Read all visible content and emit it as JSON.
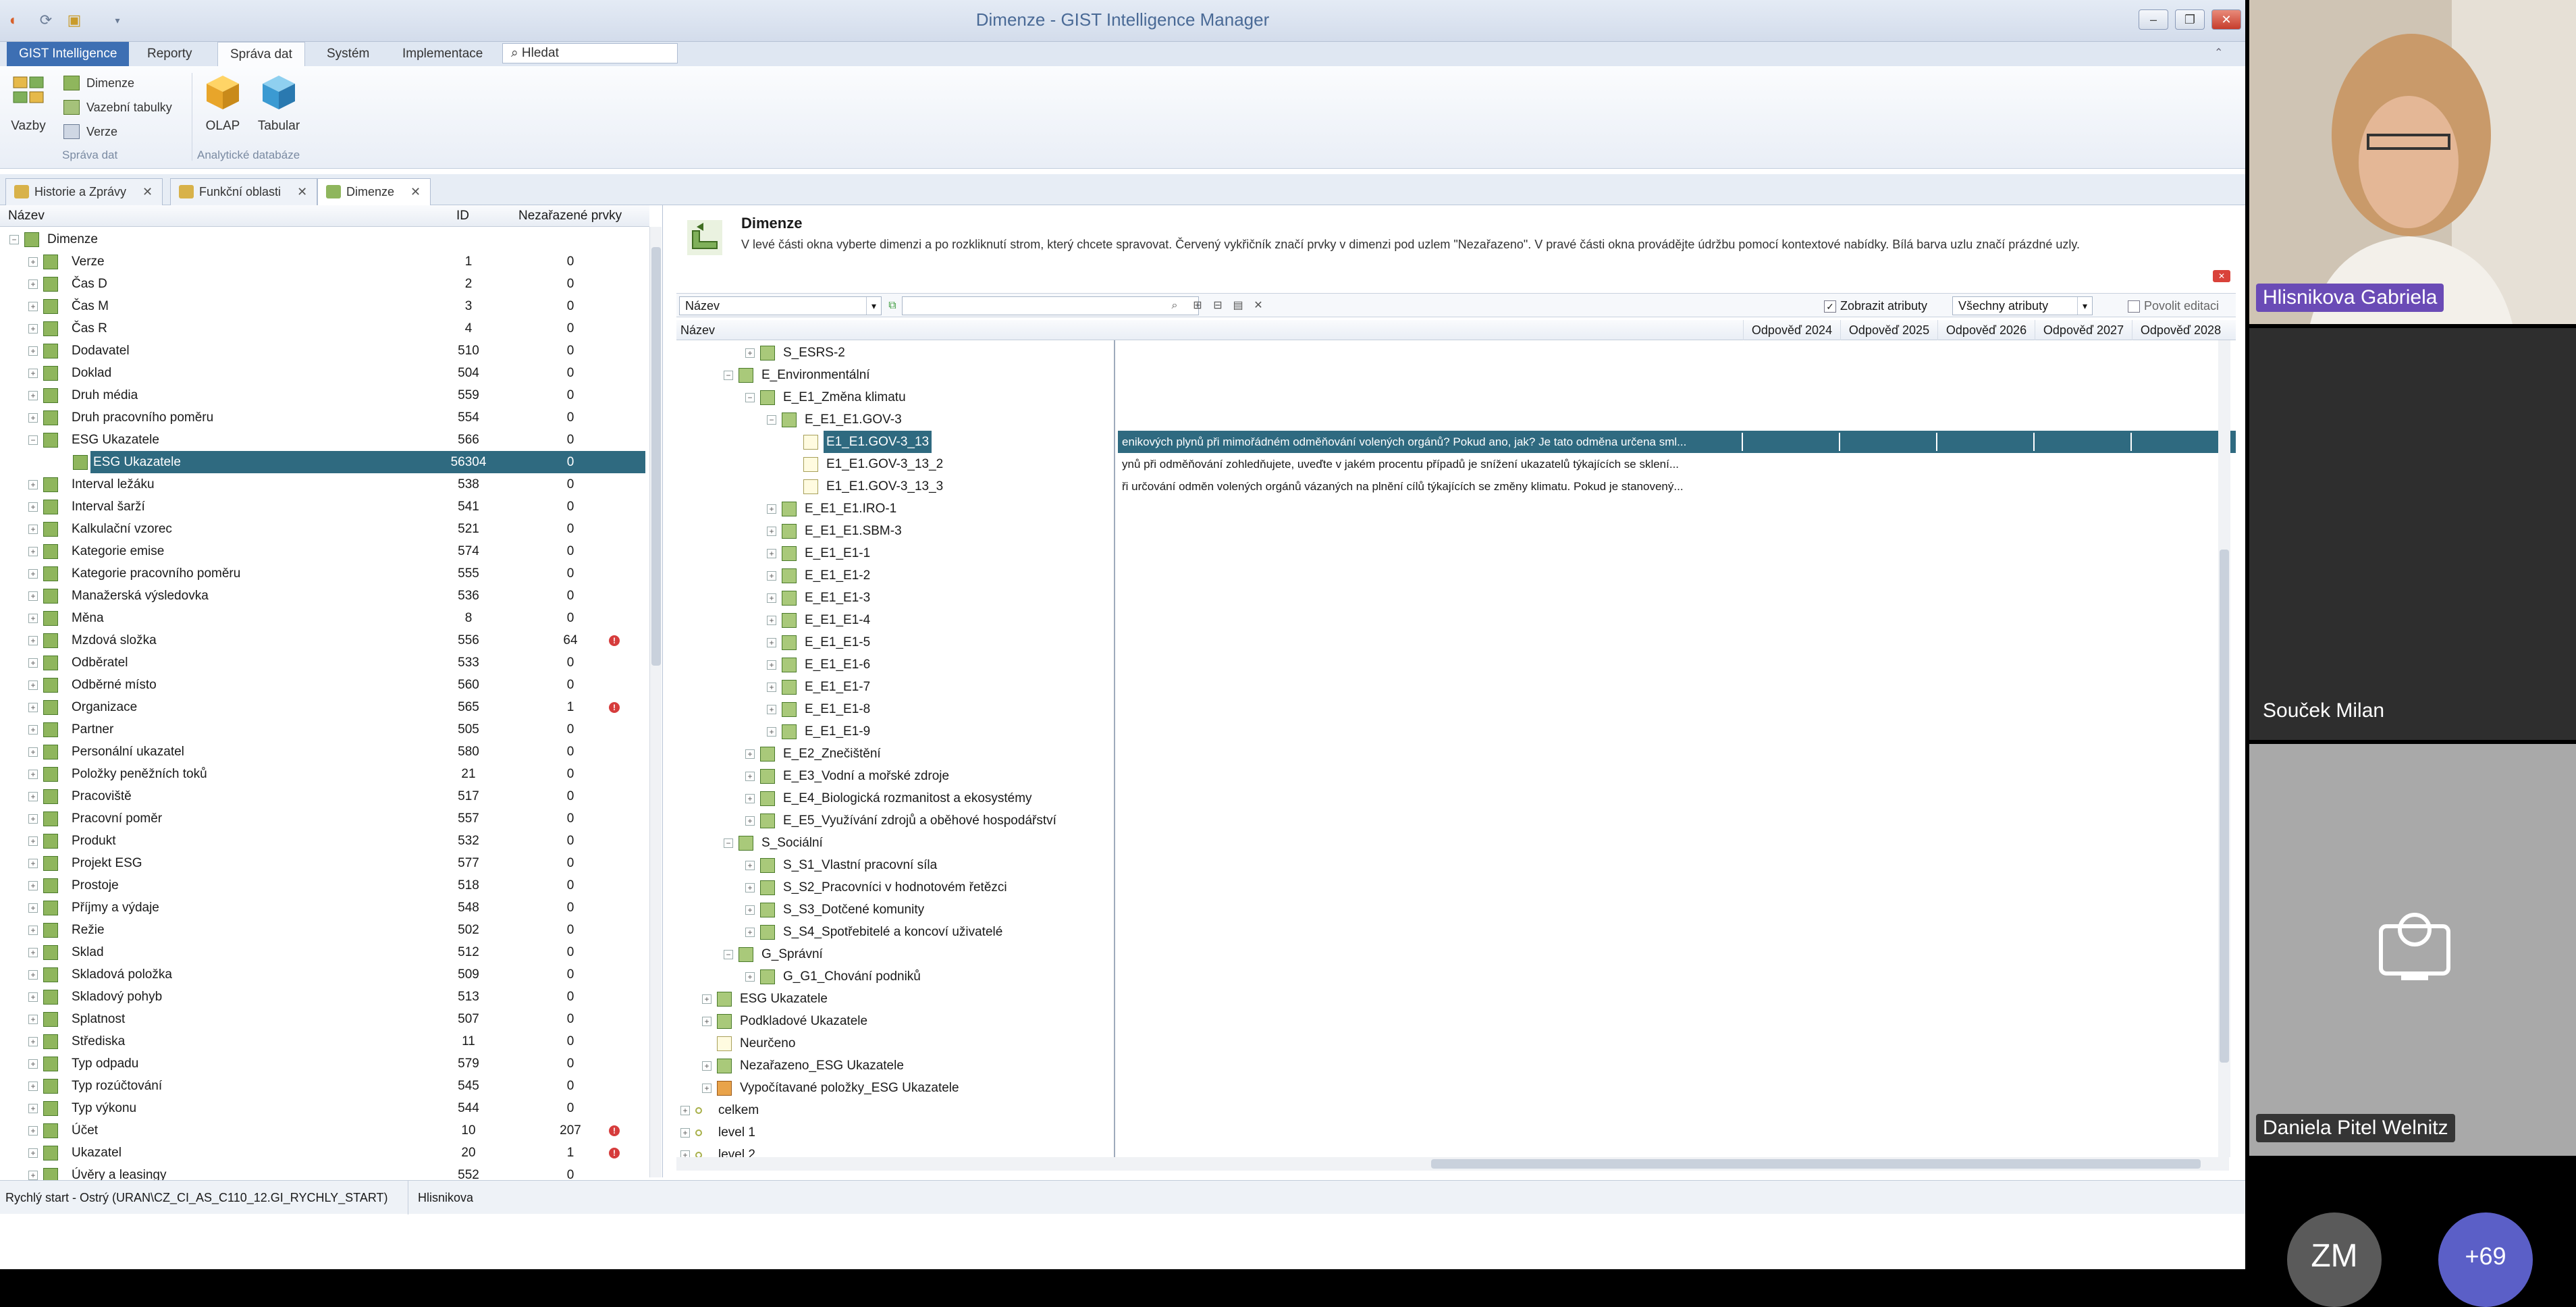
{
  "window": {
    "title": "Dimenze - GIST Intelligence Manager"
  },
  "menu": {
    "tabs": [
      "GIST Intelligence",
      "Reporty",
      "Správa dat",
      "Systém",
      "Implementace"
    ],
    "search_value": "Hledat"
  },
  "ribbon": {
    "vazby": "Vazby",
    "dimenze": "Dimenze",
    "vazebni": "Vazební tabulky",
    "verze": "Verze",
    "olap": "OLAP",
    "tabular": "Tabular",
    "group1": "Správa dat",
    "group2": "Analytické databáze"
  },
  "doc_tabs": [
    "Historie a Zprávy",
    "Funkční oblasti",
    "Dimenze"
  ],
  "left": {
    "headers": {
      "name": "Název",
      "id": "ID",
      "unassigned": "Nezařazené prvky"
    },
    "root": "Dimenze",
    "rows": [
      {
        "name": "Verze",
        "id": "1",
        "n": "0"
      },
      {
        "name": "Čas D",
        "id": "2",
        "n": "0"
      },
      {
        "name": "Čas M",
        "id": "3",
        "n": "0"
      },
      {
        "name": "Čas R",
        "id": "4",
        "n": "0"
      },
      {
        "name": "Dodavatel",
        "id": "510",
        "n": "0"
      },
      {
        "name": "Doklad",
        "id": "504",
        "n": "0"
      },
      {
        "name": "Druh média",
        "id": "559",
        "n": "0"
      },
      {
        "name": "Druh pracovního poměru",
        "id": "554",
        "n": "0"
      },
      {
        "name": "ESG Ukazatele",
        "id": "566",
        "n": "0"
      },
      {
        "name": "ESG Ukazatele",
        "id": "56304",
        "n": "0"
      },
      {
        "name": "Interval ležáku",
        "id": "538",
        "n": "0"
      },
      {
        "name": "Interval šarží",
        "id": "541",
        "n": "0"
      },
      {
        "name": "Kalkulační vzorec",
        "id": "521",
        "n": "0"
      },
      {
        "name": "Kategorie emise",
        "id": "574",
        "n": "0"
      },
      {
        "name": "Kategorie pracovního poměru",
        "id": "555",
        "n": "0"
      },
      {
        "name": "Manažerská výsledovka",
        "id": "536",
        "n": "0"
      },
      {
        "name": "Měna",
        "id": "8",
        "n": "0"
      },
      {
        "name": "Mzdová složka",
        "id": "556",
        "n": "64"
      },
      {
        "name": "Odběratel",
        "id": "533",
        "n": "0"
      },
      {
        "name": "Odběrné místo",
        "id": "560",
        "n": "0"
      },
      {
        "name": "Organizace",
        "id": "565",
        "n": "1"
      },
      {
        "name": "Partner",
        "id": "505",
        "n": "0"
      },
      {
        "name": "Personální ukazatel",
        "id": "580",
        "n": "0"
      },
      {
        "name": "Položky peněžních toků",
        "id": "21",
        "n": "0"
      },
      {
        "name": "Pracoviště",
        "id": "517",
        "n": "0"
      },
      {
        "name": "Pracovní poměr",
        "id": "557",
        "n": "0"
      },
      {
        "name": "Produkt",
        "id": "532",
        "n": "0"
      },
      {
        "name": "Projekt ESG",
        "id": "577",
        "n": "0"
      },
      {
        "name": "Prostoje",
        "id": "518",
        "n": "0"
      },
      {
        "name": "Příjmy a výdaje",
        "id": "548",
        "n": "0"
      },
      {
        "name": "Režie",
        "id": "502",
        "n": "0"
      },
      {
        "name": "Sklad",
        "id": "512",
        "n": "0"
      },
      {
        "name": "Skladová položka",
        "id": "509",
        "n": "0"
      },
      {
        "name": "Skladový pohyb",
        "id": "513",
        "n": "0"
      },
      {
        "name": "Splatnost",
        "id": "507",
        "n": "0"
      },
      {
        "name": "Střediska",
        "id": "11",
        "n": "0"
      },
      {
        "name": "Typ odpadu",
        "id": "579",
        "n": "0"
      },
      {
        "name": "Typ rozúčtování",
        "id": "545",
        "n": "0"
      },
      {
        "name": "Typ výkonu",
        "id": "544",
        "n": "0"
      },
      {
        "name": "Účet",
        "id": "10",
        "n": "207"
      },
      {
        "name": "Ukazatel",
        "id": "20",
        "n": "1"
      },
      {
        "name": "Úvěry a leasingy",
        "id": "552",
        "n": "0"
      }
    ]
  },
  "right": {
    "help_title": "Dimenze",
    "help_text": "V levé části okna vyberte dimenzi a po rozkliknutí strom, který chcete spravovat. Červený vykřičník značí prvky v dimenzi pod uzlem \"Nezařazeno\". V pravé části okna provádějte údržbu pomocí kontextové nabídky. Bílá barva uzlu značí prázdné uzly.",
    "combo_value": "Název",
    "show_attrs": "Zobrazit atributy",
    "attrs_value": "Všechny atributy",
    "allow_edit": "Povolit editaci",
    "headers": [
      "Název",
      "Odpověď 2024",
      "Odpověď 2025",
      "Odpověď 2026",
      "Odpověď 2027",
      "Odpověď 2028"
    ],
    "rows": [
      {
        "name": "S_ESRS-2",
        "desc": ""
      },
      {
        "name": "E_Environmentální",
        "desc": ""
      },
      {
        "name": "E_E1_Změna klimatu",
        "desc": ""
      },
      {
        "name": "E_E1_E1.GOV-3",
        "desc": ""
      },
      {
        "name": "E1_E1.GOV-3_13",
        "desc": "enikových plynů při mimořádném odměňování volených orgánů? Pokud ano, jak? Je tato odměna určena sml..."
      },
      {
        "name": "E1_E1.GOV-3_13_2",
        "desc": "ynů při odměňování zohledňujete, uveďte v jakém procentu případů je snížení ukazatelů týkajících se sklení..."
      },
      {
        "name": "E1_E1.GOV-3_13_3",
        "desc": "ři určování odměn volených orgánů vázaných na plnění cílů týkajících se změny klimatu. Pokud je stanovený..."
      },
      {
        "name": "E_E1_E1.IRO-1",
        "desc": ""
      },
      {
        "name": "E_E1_E1.SBM-3",
        "desc": ""
      },
      {
        "name": "E_E1_E1-1",
        "desc": ""
      },
      {
        "name": "E_E1_E1-2",
        "desc": ""
      },
      {
        "name": "E_E1_E1-3",
        "desc": ""
      },
      {
        "name": "E_E1_E1-4",
        "desc": ""
      },
      {
        "name": "E_E1_E1-5",
        "desc": ""
      },
      {
        "name": "E_E1_E1-6",
        "desc": ""
      },
      {
        "name": "E_E1_E1-7",
        "desc": ""
      },
      {
        "name": "E_E1_E1-8",
        "desc": ""
      },
      {
        "name": "E_E1_E1-9",
        "desc": ""
      },
      {
        "name": "E_E2_Znečištění",
        "desc": ""
      },
      {
        "name": "E_E3_Vodní a mořské zdroje",
        "desc": ""
      },
      {
        "name": "E_E4_Biologická rozmanitost a ekosystémy",
        "desc": ""
      },
      {
        "name": "E_E5_Využívání zdrojů a oběhové hospodářství",
        "desc": ""
      },
      {
        "name": "S_Sociální",
        "desc": ""
      },
      {
        "name": "S_S1_Vlastní pracovní síla",
        "desc": ""
      },
      {
        "name": "S_S2_Pracovníci v hodnotovém řetězci",
        "desc": ""
      },
      {
        "name": "S_S3_Dotčené komunity",
        "desc": ""
      },
      {
        "name": "S_S4_Spotřebitelé a koncoví uživatelé",
        "desc": ""
      },
      {
        "name": "G_Správní",
        "desc": ""
      },
      {
        "name": "G_G1_Chování podniků",
        "desc": ""
      },
      {
        "name": "ESG Ukazatele",
        "desc": ""
      },
      {
        "name": "Podkladové Ukazatele",
        "desc": ""
      },
      {
        "name": "Neurčeno",
        "desc": ""
      },
      {
        "name": "Nezařazeno_ESG Ukazatele",
        "desc": ""
      },
      {
        "name": "Vypočítavané položky_ESG Ukazatele",
        "desc": ""
      },
      {
        "name": "celkem",
        "desc": ""
      },
      {
        "name": "level 1",
        "desc": ""
      },
      {
        "name": "level 2",
        "desc": ""
      }
    ]
  },
  "status": {
    "connection": "Rychlý start - Ostrý (URAN\\CZ_CI_AS_C110_12.GI_RYCHLY_START)",
    "user": "Hlisnikova"
  },
  "video": {
    "p1": "Hlisnikova Gabriela",
    "p2": "Souček Milan",
    "p3": "Daniela Pitel Welnitz",
    "initials": "ZM",
    "more": "+69"
  },
  "colors": {
    "selection": "#2f6a80",
    "accent": "#3d6fb3",
    "speaker_label": "#6a4bb6",
    "warning": "#d63c3c"
  }
}
